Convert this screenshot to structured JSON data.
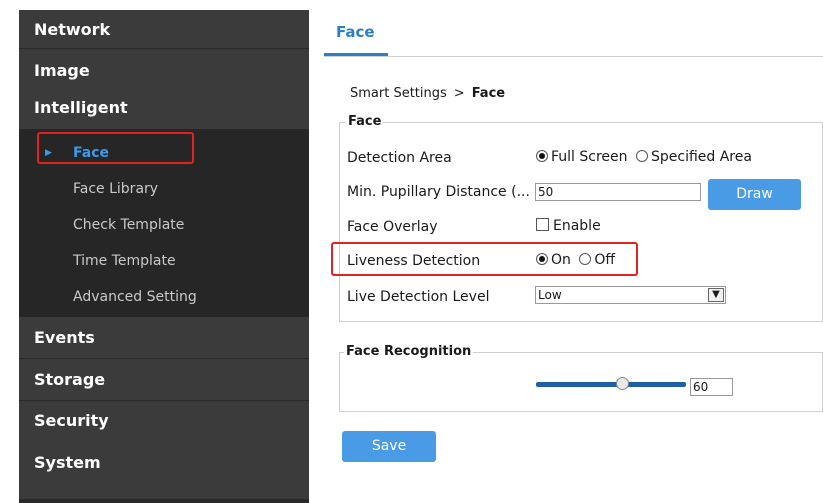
{
  "sidebar": {
    "menus": {
      "network": "Network",
      "image": "Image",
      "intelligent": "Intelligent",
      "events": "Events",
      "storage": "Storage",
      "security": "Security",
      "system": "System"
    },
    "intelligent_items": [
      {
        "label": "Face",
        "active": true
      },
      {
        "label": "Face Library"
      },
      {
        "label": "Check Template"
      },
      {
        "label": "Time Template"
      },
      {
        "label": "Advanced Setting"
      }
    ]
  },
  "tabs": [
    {
      "label": "Face",
      "active": true
    }
  ],
  "breadcrumb": {
    "parent": "Smart Settings",
    "separator": ">",
    "current": "Face"
  },
  "face_section": {
    "title": "Face",
    "detection_area": {
      "label": "Detection Area",
      "options": [
        "Full Screen",
        "Specified Area"
      ],
      "selected": "Full Screen"
    },
    "min_pupillary": {
      "label": "Min. Pupillary Distance (...",
      "value": "50",
      "button": "Draw"
    },
    "face_overlay": {
      "label": "Face Overlay",
      "checkbox_label": "Enable",
      "checked": false
    },
    "liveness": {
      "label": "Liveness Detection",
      "options": [
        "On",
        "Off"
      ],
      "selected": "On"
    },
    "live_level": {
      "label": "Live Detection Level",
      "value": "Low"
    }
  },
  "recognition_section": {
    "title": "Face Recognition",
    "value": "60",
    "level_fraction": 0.6
  },
  "save_label": "Save",
  "colors": {
    "sidebar_bg": "#3b3b3b",
    "submenu_bg": "#262626",
    "accent": "#3c9ae8",
    "button": "#4a9be6",
    "highlight": "#e32121"
  }
}
